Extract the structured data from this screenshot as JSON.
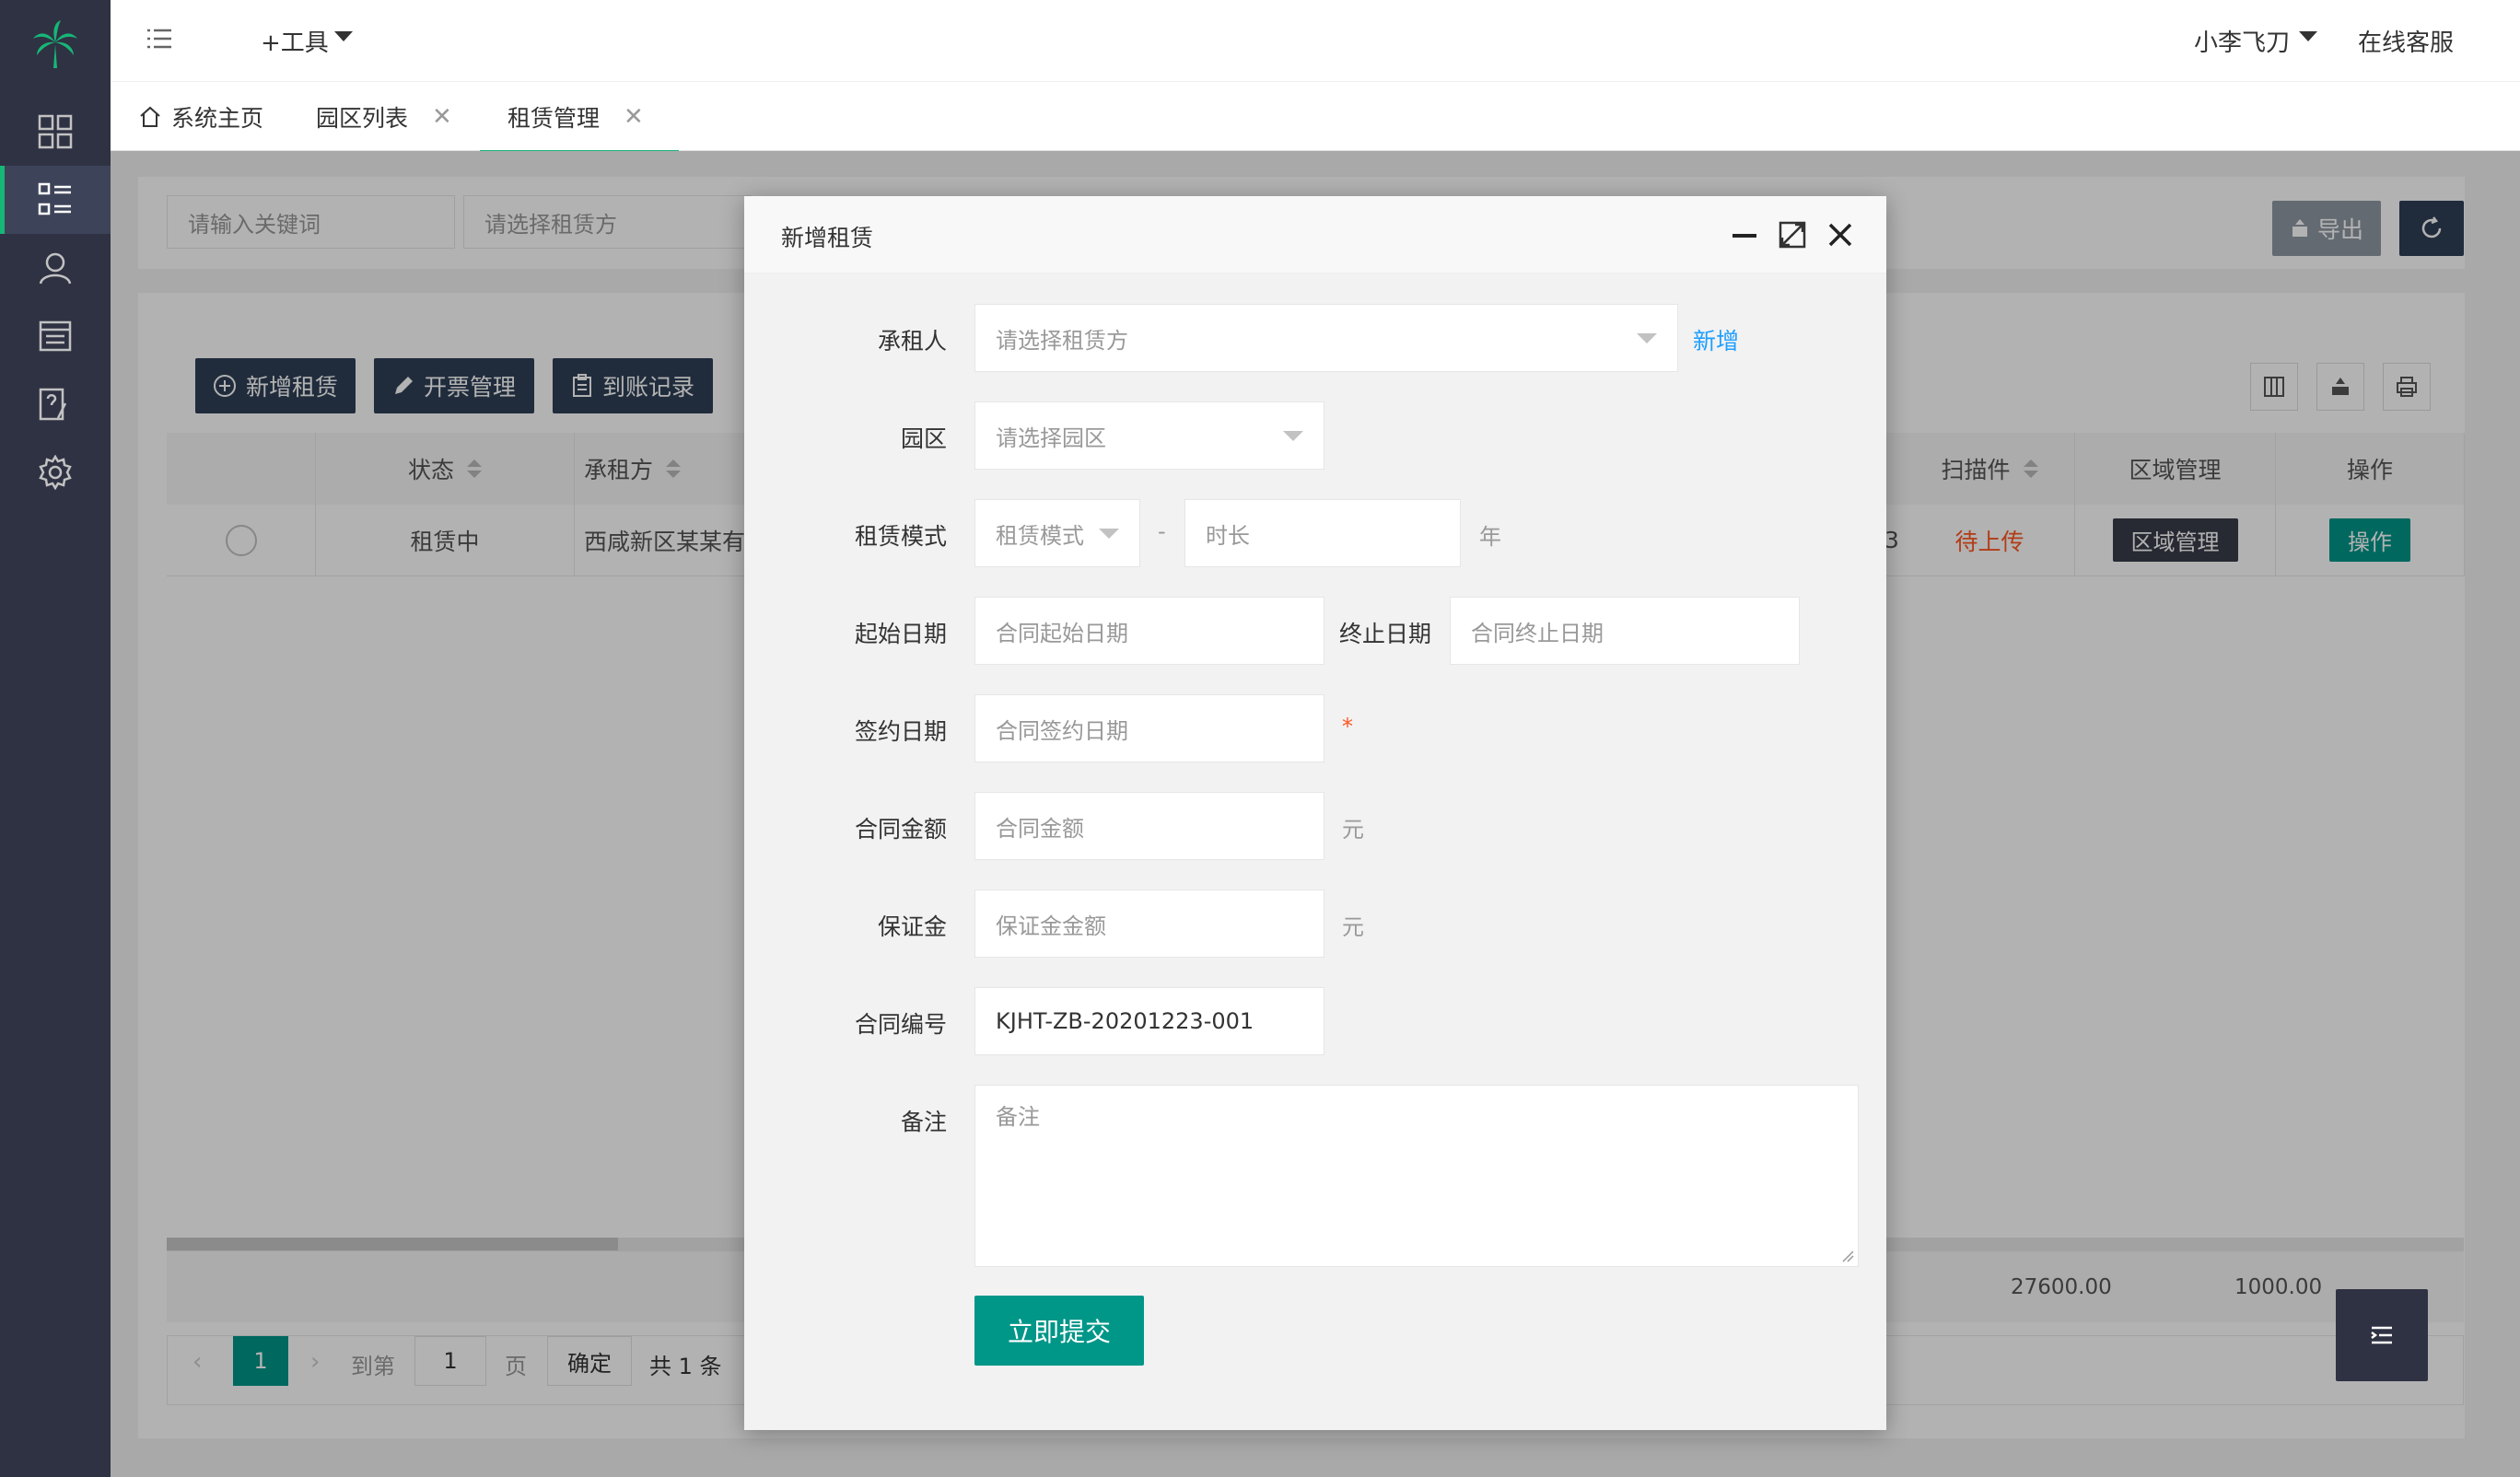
{
  "header": {
    "tools_label": "+工具",
    "user_name": "小李飞刀",
    "service_label": "在线客服"
  },
  "tabs": [
    {
      "label": "系统主页"
    },
    {
      "label": "园区列表"
    },
    {
      "label": "租赁管理"
    }
  ],
  "search": {
    "keyword_placeholder": "请输入关键词",
    "lessor_placeholder": "请选择租赁方",
    "export_label": "导出"
  },
  "toolbar": {
    "add_lease": "新增租赁",
    "invoice": "开票管理",
    "arrival": "到账记录"
  },
  "table": {
    "headers": {
      "status": "状态",
      "lessor": "承租方",
      "scan": "扫描件",
      "area": "区域管理",
      "action": "操作"
    },
    "row": {
      "status": "租赁中",
      "lessor": "西咸新区某某有限",
      "partial": "3",
      "scan": "待上传",
      "area": "区域管理",
      "action": "操作"
    },
    "totals": {
      "amount": "27600.00",
      "deposit": "1000.00"
    }
  },
  "pager": {
    "current": "1",
    "goto_label": "到第",
    "page_value": "1",
    "page_label": "页",
    "confirm": "确定",
    "total": "共 1 条"
  },
  "modal": {
    "title": "新增租赁",
    "fields": {
      "tenant_label": "承租人",
      "tenant_placeholder": "请选择租赁方",
      "tenant_add": "新增",
      "park_label": "园区",
      "park_placeholder": "请选择园区",
      "mode_label": "租赁模式",
      "mode_placeholder": "租赁模式",
      "mode_sep": "-",
      "duration_placeholder": "时长",
      "duration_unit": "年",
      "start_label": "起始日期",
      "start_placeholder": "合同起始日期",
      "end_label": "终止日期",
      "end_placeholder": "合同终止日期",
      "sign_label": "签约日期",
      "sign_placeholder": "合同签约日期",
      "sign_required": "*",
      "amount_label": "合同金额",
      "amount_placeholder": "合同金额",
      "amount_unit": "元",
      "deposit_label": "保证金",
      "deposit_placeholder": "保证金金额",
      "deposit_unit": "元",
      "contract_label": "合同编号",
      "contract_value": "KJHT-ZB-20201223-001",
      "remark_label": "备注",
      "remark_placeholder": "备注"
    },
    "submit": "立即提交"
  },
  "colors": {
    "sidebar": "#2f3243",
    "accent": "#16b777",
    "primary": "#009688",
    "dark_button": "#2f4056",
    "link": "#1e9fff",
    "danger": "#ff5722"
  }
}
